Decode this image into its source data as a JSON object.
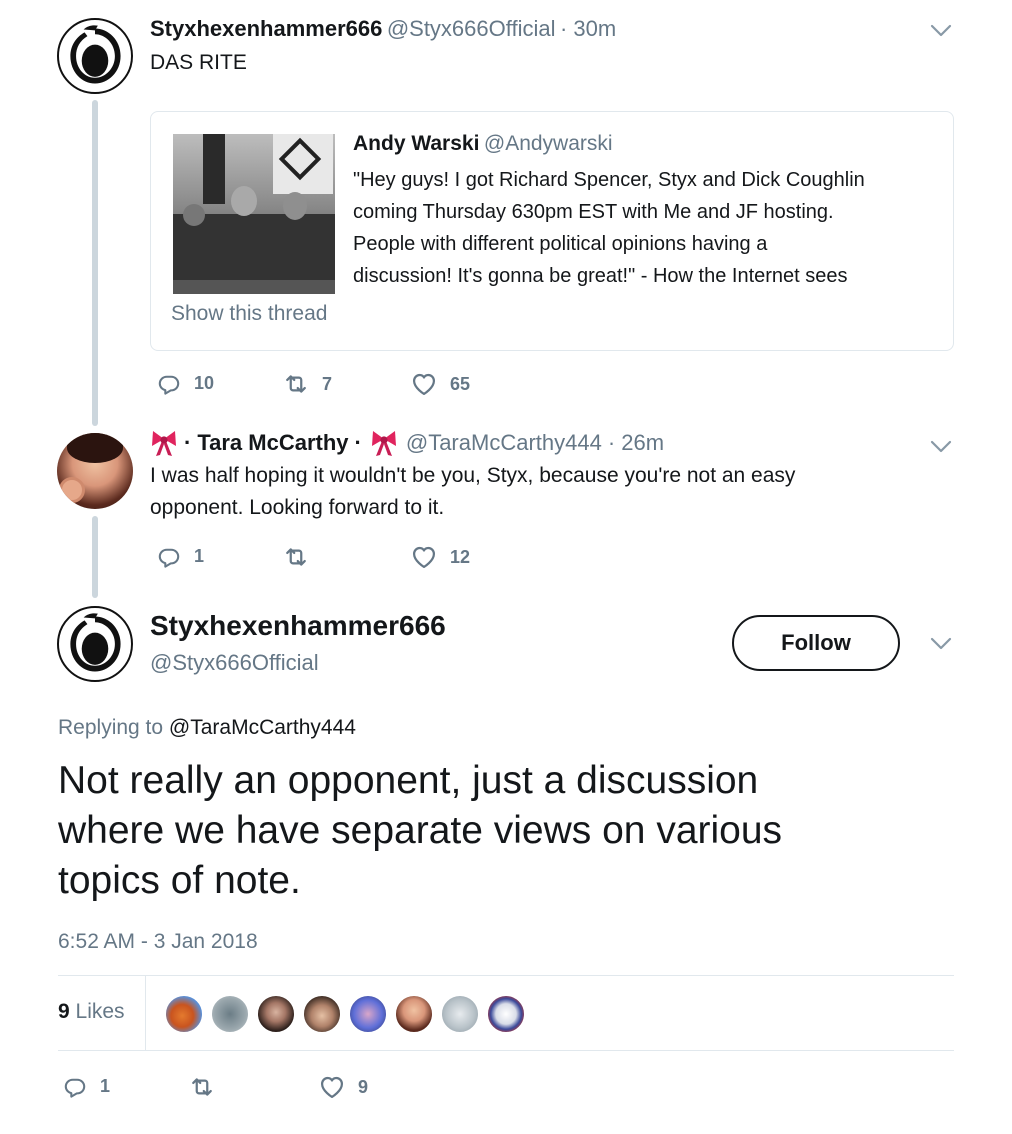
{
  "parent_tweet": {
    "name": "Styxhexenhammer666",
    "handle": "@Styx666Official",
    "time": "· 30m",
    "text": "DAS RITE",
    "quote": {
      "name": "Andy Warski",
      "handle": "@Andywarski",
      "lines": [
        "\"Hey guys! I got Richard Spencer, Styx and Dick Coughlin",
        "coming Thursday 630pm EST with Me and JF hosting.",
        "People with different political opinions having a",
        "discussion! It's gonna be great!\" - How the Internet sees"
      ],
      "show_thread": "Show this thread"
    },
    "actions": {
      "replies": "10",
      "retweets": "7",
      "likes": "65"
    }
  },
  "reply_tweet": {
    "prefix": "·",
    "name": "Tara McCarthy",
    "suffix": "·",
    "handle": "@TaraMcCarthy444",
    "time": "· 26m",
    "lines": [
      "I was half hoping it wouldn't be you, Styx, because you're not an easy",
      "opponent. Looking forward to it."
    ],
    "actions": {
      "replies": "1",
      "retweets": "",
      "likes": "12"
    }
  },
  "main_tweet": {
    "name": "Styxhexenhammer666",
    "handle": "@Styx666Official",
    "follow_label": "Follow",
    "replying_label": "Replying to",
    "replying_to": "@TaraMcCarthy444",
    "lines": [
      "Not really an opponent, just a discussion",
      "where we have separate views on various",
      "topics of note."
    ],
    "timestamp": "6:52 AM - 3 Jan 2018",
    "likes_count": "9",
    "likes_label": "Likes",
    "actions": {
      "replies": "1",
      "retweets": "",
      "likes": "9"
    }
  },
  "icons": {
    "reply": "reply-icon",
    "retweet": "retweet-icon",
    "like": "heart-icon",
    "caret": "chevron-down-icon",
    "bow": "ribbon-emoji"
  },
  "colors": {
    "text": "#14171a",
    "muted": "#657786",
    "border": "#e1e8ed",
    "thread_line": "#ccd6dd",
    "ribbon": "#e0245e"
  }
}
